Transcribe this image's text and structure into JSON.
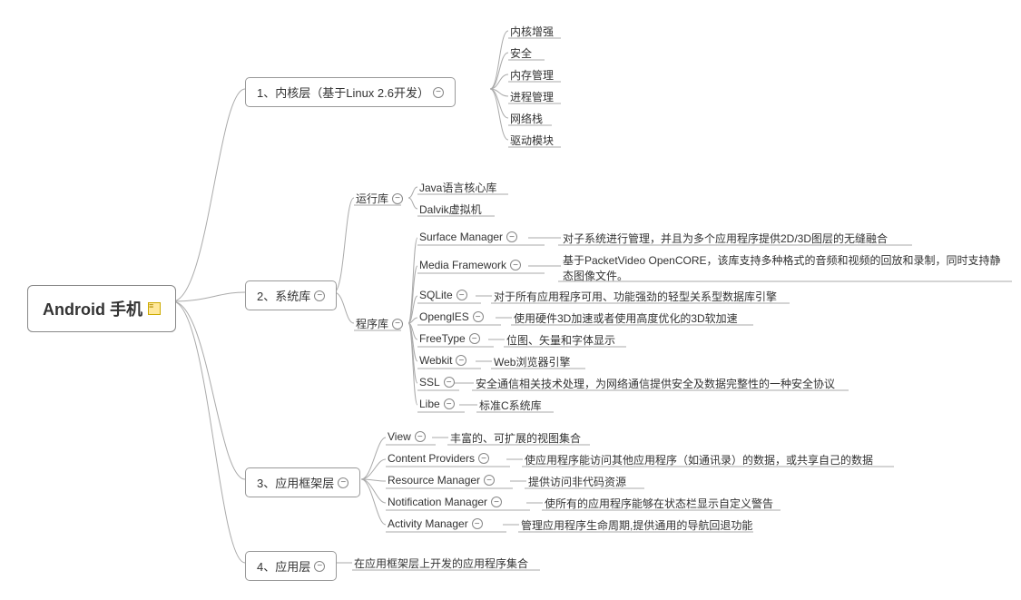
{
  "root": {
    "label": "Android 手机",
    "hasNote": true
  },
  "level1": [
    {
      "id": "n1",
      "label": "1、内核层（基于Linux 2.6开发）",
      "hasBtn": true
    },
    {
      "id": "n2",
      "label": "2、系统库",
      "hasBtn": true
    },
    {
      "id": "n3",
      "label": "3、应用框架层",
      "hasBtn": true
    },
    {
      "id": "n4",
      "label": "4、应用层",
      "hasBtn": true
    }
  ],
  "n1_children": [
    {
      "label": "内核增强"
    },
    {
      "label": "安全"
    },
    {
      "label": "内存管理"
    },
    {
      "label": "进程管理"
    },
    {
      "label": "网络栈"
    },
    {
      "label": "驱动模块"
    }
  ],
  "n2_sub": [
    {
      "id": "rtlib",
      "label": "运行库",
      "hasBtn": true
    },
    {
      "id": "prglib",
      "label": "程序库",
      "hasBtn": true
    }
  ],
  "rtlib_children": [
    {
      "label": "Java语言核心库"
    },
    {
      "label": "Dalvik虚拟机"
    }
  ],
  "prglib_children": [
    {
      "label": "Surface Manager",
      "hasBtn": true,
      "desc": "对子系统进行管理，并且为多个应用程序提供2D/3D图层的无缝融合"
    },
    {
      "label": "Media Framework",
      "hasBtn": true,
      "desc": "基于PacketVideo OpenCORE，该库支持多种格式的音频和视频的回放和录制，同时支持静态图像文件。"
    },
    {
      "label": "SQLite",
      "hasBtn": true,
      "desc": "对于所有应用程序可用、功能强劲的轻型关系型数据库引擎"
    },
    {
      "label": "OpenglES",
      "hasBtn": true,
      "desc": "使用硬件3D加速或者使用高度优化的3D软加速"
    },
    {
      "label": "FreeType",
      "hasBtn": true,
      "desc": "位图、矢量和字体显示"
    },
    {
      "label": "Webkit",
      "hasBtn": true,
      "desc": "Web浏览器引擎"
    },
    {
      "label": "SSL",
      "hasBtn": true,
      "desc": "安全通信相关技术处理，为网络通信提供安全及数据完整性的一种安全协议"
    },
    {
      "label": "Libe",
      "hasBtn": true,
      "desc": "标准C系统库"
    }
  ],
  "n3_children": [
    {
      "label": "View",
      "hasBtn": true,
      "desc": "丰富的、可扩展的视图集合"
    },
    {
      "label": "Content Providers",
      "hasBtn": true,
      "desc": "使应用程序能访问其他应用程序（如通讯录）的数据，或共享自己的数据"
    },
    {
      "label": "Resource Manager",
      "hasBtn": true,
      "desc": "提供访问非代码资源"
    },
    {
      "label": "Notification Manager",
      "hasBtn": true,
      "desc": "使所有的应用程序能够在状态栏显示自定义警告"
    },
    {
      "label": "Activity Manager",
      "hasBtn": true,
      "desc": "管理应用程序生命周期,提供通用的导航回退功能"
    }
  ],
  "n4_desc": "在应用框架层上开发的应用程序集合",
  "minus": "−"
}
